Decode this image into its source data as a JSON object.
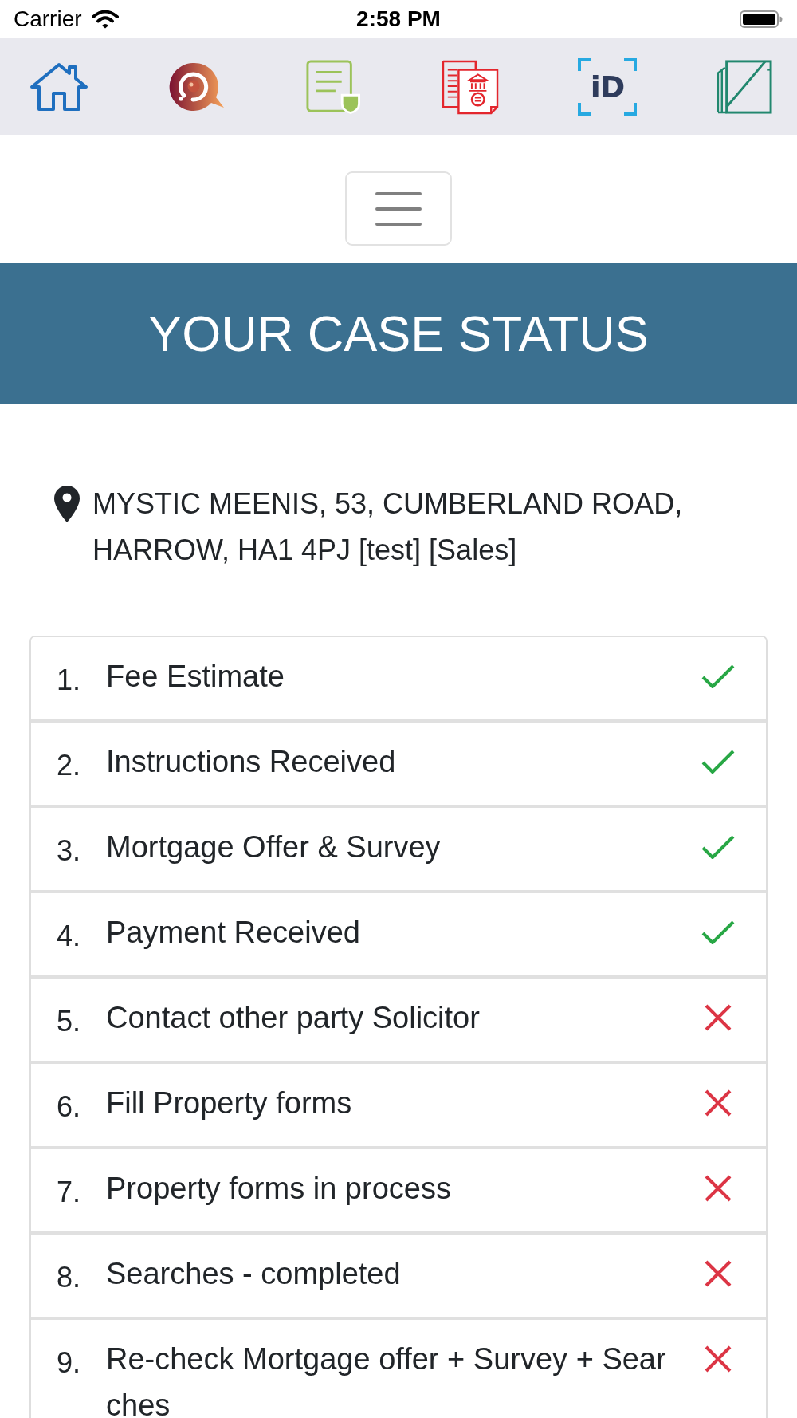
{
  "status_bar": {
    "carrier": "Carrier",
    "time": "2:58 PM"
  },
  "toolbar": {
    "items": [
      {
        "kind": "home"
      },
      {
        "kind": "chat"
      },
      {
        "kind": "document-shield"
      },
      {
        "kind": "bank-document"
      },
      {
        "kind": "id-scan",
        "text": "iD"
      },
      {
        "kind": "folders"
      }
    ]
  },
  "header": {
    "title": "YOUR CASE STATUS"
  },
  "address": {
    "text": "MYSTIC MEENIS, 53, CUMBERLAND ROAD, HARROW, HA1 4PJ [test] [Sales]"
  },
  "steps": [
    {
      "number": "1.",
      "label": "Fee Estimate",
      "done": true
    },
    {
      "number": "2.",
      "label": "Instructions Received",
      "done": true
    },
    {
      "number": "3.",
      "label": "Mortgage Offer & Survey",
      "done": true
    },
    {
      "number": "4.",
      "label": "Payment Received",
      "done": true
    },
    {
      "number": "5.",
      "label": "Contact other party Solicitor",
      "done": false
    },
    {
      "number": "6.",
      "label": "Fill Property forms",
      "done": false
    },
    {
      "number": "7.",
      "label": "Property forms in process",
      "done": false
    },
    {
      "number": "8.",
      "label": "Searches - completed",
      "done": false
    },
    {
      "number": "9.",
      "label": "Re-check Mortgage offer + Survey + Searches",
      "done": false
    }
  ]
}
